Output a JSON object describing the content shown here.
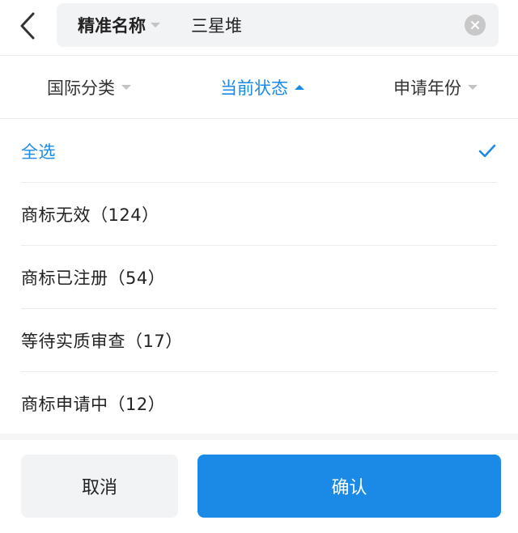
{
  "header": {
    "mode_label": "精准名称",
    "search_value": "三星堆"
  },
  "tabs": [
    {
      "label": "国际分类",
      "active": false
    },
    {
      "label": "当前状态",
      "active": true
    },
    {
      "label": "申请年份",
      "active": false
    }
  ],
  "options": [
    {
      "label": "全选",
      "selected": true
    },
    {
      "label": "商标无效（124）",
      "selected": false
    },
    {
      "label": "商标已注册（54）",
      "selected": false
    },
    {
      "label": "等待实质审查（17）",
      "selected": false
    },
    {
      "label": "商标申请中（12）",
      "selected": false
    }
  ],
  "footer": {
    "cancel_label": "取消",
    "confirm_label": "确认"
  },
  "colors": {
    "accent": "#1a8ae6",
    "text": "#222222",
    "muted": "#c4c4c4",
    "field_bg": "#f2f3f5"
  }
}
